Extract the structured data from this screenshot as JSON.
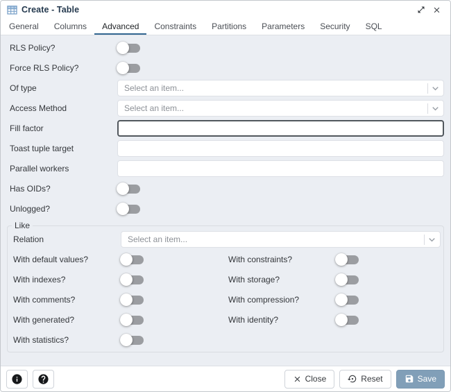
{
  "colors": {
    "accent": "#326690",
    "body_bg": "#ebeef3",
    "header_bg": "#ffffff",
    "border": "#dde0e6",
    "toggle_track": "#9b9da1",
    "save_button_bg": "#819fb8",
    "placeholder_text": "#8d9197"
  },
  "icons": {
    "title": "table-icon",
    "maximize": "open-in-full-icon",
    "close": "close-icon",
    "select_chevron": "chevron-down-icon",
    "info": "info-icon",
    "help": "help-icon",
    "close_button": "close-x-icon",
    "reset_button": "restore-arrow-icon",
    "save_button": "floppy-disk-icon"
  },
  "header": {
    "title": "Create - Table"
  },
  "tabs": {
    "items": [
      "General",
      "Columns",
      "Advanced",
      "Constraints",
      "Partitions",
      "Parameters",
      "Security",
      "SQL"
    ],
    "active": "Advanced"
  },
  "form": {
    "toggles_top": [
      {
        "label": "RLS Policy?",
        "state": "off"
      },
      {
        "label": "Force RLS Policy?",
        "state": "off"
      }
    ],
    "selects": [
      {
        "label": "Of type",
        "placeholder": "Select an item...",
        "value": ""
      },
      {
        "label": "Access Method",
        "placeholder": "Select an item...",
        "value": ""
      }
    ],
    "inputs": [
      {
        "label": "Fill factor",
        "value": "",
        "placeholder": "",
        "focused": true
      },
      {
        "label": "Toast tuple target",
        "value": "",
        "placeholder": "",
        "focused": false
      },
      {
        "label": "Parallel workers",
        "value": "",
        "placeholder": "",
        "focused": false
      }
    ],
    "toggles_mid": [
      {
        "label": "Has OIDs?",
        "state": "off"
      },
      {
        "label": "Unlogged?",
        "state": "off"
      }
    ],
    "like_section": {
      "legend": "Like",
      "relation": {
        "label": "Relation",
        "placeholder": "Select an item...",
        "value": ""
      },
      "toggle_rows": [
        {
          "left": {
            "label": "With default values?",
            "state": "off"
          },
          "right": {
            "label": "With constraints?",
            "state": "off"
          }
        },
        {
          "left": {
            "label": "With indexes?",
            "state": "off"
          },
          "right": {
            "label": "With storage?",
            "state": "off"
          }
        },
        {
          "left": {
            "label": "With comments?",
            "state": "off"
          },
          "right": {
            "label": "With compression?",
            "state": "off"
          }
        },
        {
          "left": {
            "label": "With generated?",
            "state": "off"
          },
          "right": {
            "label": "With identity?",
            "state": "off"
          }
        },
        {
          "left": {
            "label": "With statistics?",
            "state": "off"
          }
        }
      ]
    }
  },
  "footer": {
    "close_label": "Close",
    "reset_label": "Reset",
    "save_label": "Save"
  }
}
